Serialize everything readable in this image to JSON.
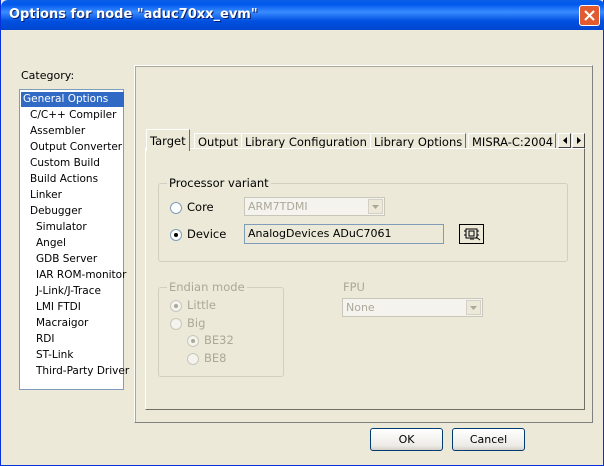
{
  "window": {
    "title": "Options for node \"aduc70xx_evm\""
  },
  "category": {
    "label": "Category:",
    "selected": "General Options",
    "items": [
      {
        "label": "General Options",
        "indent": 0
      },
      {
        "label": "C/C++ Compiler",
        "indent": 1
      },
      {
        "label": "Assembler",
        "indent": 1
      },
      {
        "label": "Output Converter",
        "indent": 1
      },
      {
        "label": "Custom Build",
        "indent": 1
      },
      {
        "label": "Build Actions",
        "indent": 1
      },
      {
        "label": "Linker",
        "indent": 1
      },
      {
        "label": "Debugger",
        "indent": 1
      },
      {
        "label": "Simulator",
        "indent": 2
      },
      {
        "label": "Angel",
        "indent": 2
      },
      {
        "label": "GDB Server",
        "indent": 2
      },
      {
        "label": "IAR ROM-monitor",
        "indent": 2
      },
      {
        "label": "J-Link/J-Trace",
        "indent": 2
      },
      {
        "label": "LMI FTDI",
        "indent": 2
      },
      {
        "label": "Macraigor",
        "indent": 2
      },
      {
        "label": "RDI",
        "indent": 2
      },
      {
        "label": "ST-Link",
        "indent": 2
      },
      {
        "label": "Third-Party Driver",
        "indent": 2
      }
    ]
  },
  "tabs": {
    "active": "Target",
    "items": [
      "Target",
      "Output",
      "Library Configuration",
      "Library Options",
      "MISRA-C:2004"
    ]
  },
  "processor_variant": {
    "title": "Processor variant",
    "core_label": "Core",
    "core_value": "ARM7TDMI",
    "device_label": "Device",
    "device_value": "AnalogDevices ADuC7061",
    "selected": "Device"
  },
  "endian_mode": {
    "title": "Endian mode",
    "little_label": "Little",
    "big_label": "Big",
    "be32_label": "BE32",
    "be8_label": "BE8",
    "selected": "Little",
    "big_selected": "BE32",
    "enabled": false
  },
  "fpu": {
    "label": "FPU",
    "value": "None",
    "enabled": false
  },
  "buttons": {
    "ok": "OK",
    "cancel": "Cancel"
  },
  "colors": {
    "titlebar": "#0058ee",
    "selection": "#316ac5",
    "dialog_bg": "#ece9d8"
  }
}
